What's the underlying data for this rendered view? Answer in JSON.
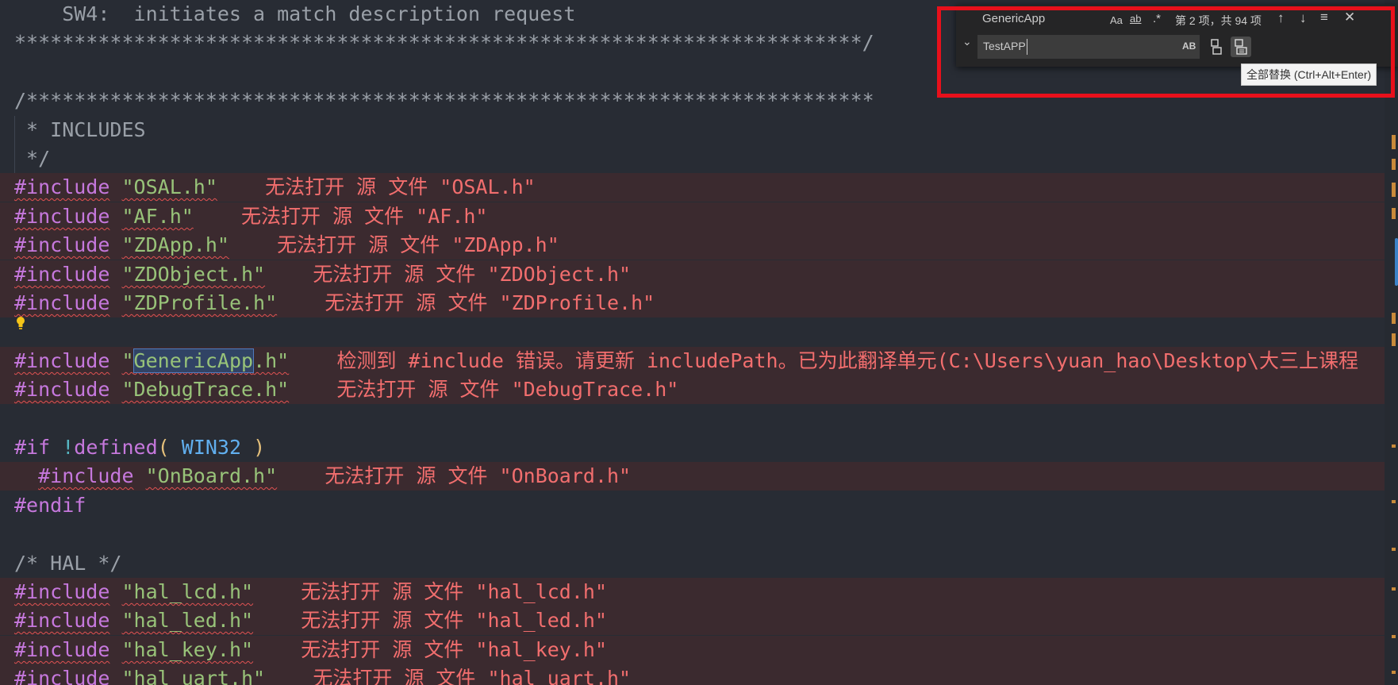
{
  "editor": {
    "lines": [
      {
        "code": "    SW4:  initiates a match description request",
        "cls": "cmt"
      },
      {
        "code": "***********************************************************************/",
        "cls": "cmt"
      },
      {
        "code": "",
        "cls": ""
      },
      {
        "code": "/***********************************************************************",
        "cls": "cmt"
      },
      {
        "code": " * INCLUDES",
        "cls": "cmt"
      },
      {
        "code": " */",
        "cls": "cmt"
      }
    ],
    "includes_block1": [
      {
        "file": "\"OSAL.h\"",
        "diag": "无法打开 源 文件 \"OSAL.h\""
      },
      {
        "file": "\"AF.h\"",
        "diag": "无法打开 源 文件 \"AF.h\""
      },
      {
        "file": "\"ZDApp.h\"",
        "diag": "无法打开 源 文件 \"ZDApp.h\""
      },
      {
        "file": "\"ZDObject.h\"",
        "diag": "无法打开 源 文件 \"ZDObject.h\""
      },
      {
        "file": "\"ZDProfile.h\"",
        "diag": "无法打开 源 文件 \"ZDProfile.h\""
      }
    ],
    "generic_include": {
      "prefix": "\"",
      "match": "GenericApp",
      "suffix": ".h\"",
      "diag": "检测到 #include 错误。请更新 includePath。已为此翻译单元(C:\\Users\\yuan_hao\\Desktop\\大三上课程"
    },
    "debug_include": {
      "file": "\"DebugTrace.h\"",
      "diag": "无法打开 源 文件 \"DebugTrace.h\""
    },
    "if_line": {
      "directive": "#if",
      "bang": "!",
      "defined": "defined",
      "open": "(",
      "macro": "WIN32",
      "close": ")"
    },
    "onboard_include": {
      "file": "\"OnBoard.h\"",
      "diag": "无法打开 源 文件 \"OnBoard.h\""
    },
    "endif": "#endif",
    "hal_comment": "/* HAL */",
    "includes_block2": [
      {
        "file": "\"hal_lcd.h\"",
        "diag": "无法打开 源 文件 \"hal_lcd.h\""
      },
      {
        "file": "\"hal_led.h\"",
        "diag": "无法打开 源 文件 \"hal_led.h\""
      },
      {
        "file": "\"hal_key.h\"",
        "diag": "无法打开 源 文件 \"hal_key.h\""
      },
      {
        "file": "\"hal_uart.h\"",
        "diag": "无法打开 源 文件 \"hal_uart.h\""
      }
    ],
    "include_kw": "#include"
  },
  "find_widget": {
    "find_value": "GenericApp",
    "match_case_label": "Aa",
    "whole_word_label": "ab",
    "regex_label": ".*",
    "match_count": "第 2 项，共 94 项",
    "replace_value": "TestAPP",
    "preserve_case_label": "AB",
    "tooltip": "全部替换 (Ctrl+Alt+Enter)"
  },
  "colors": {
    "accent": "#e8101b",
    "error_bg": "#3b2a2f",
    "diag": "#f26e6e"
  }
}
